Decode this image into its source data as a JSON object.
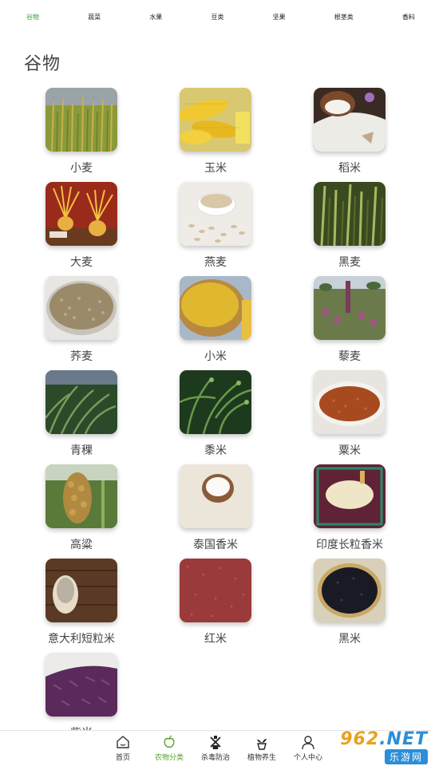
{
  "tabs": [
    "谷物",
    "蔬菜",
    "水果",
    "豆类",
    "坚果",
    "根茎类",
    "香料"
  ],
  "active_tab": "谷物",
  "section_title": "谷物",
  "items": [
    {
      "label": "小麦",
      "image": "wheat-field"
    },
    {
      "label": "玉米",
      "image": "corn-cobs"
    },
    {
      "label": "稻米",
      "image": "rice-bowl"
    },
    {
      "label": "大麦",
      "image": "barley-bundles"
    },
    {
      "label": "燕麦",
      "image": "oat-flakes"
    },
    {
      "label": "黑麦",
      "image": "rye-ears"
    },
    {
      "label": "荞麦",
      "image": "buckwheat-bowl"
    },
    {
      "label": "小米",
      "image": "millet-bowl"
    },
    {
      "label": "藜麦",
      "image": "quinoa-plants"
    },
    {
      "label": "青稞",
      "image": "highland-barley"
    },
    {
      "label": "黍米",
      "image": "proso-millet"
    },
    {
      "label": "粟米",
      "image": "foxtail-millet-grains"
    },
    {
      "label": "高粱",
      "image": "sorghum-head"
    },
    {
      "label": "泰国香米",
      "image": "jasmine-rice"
    },
    {
      "label": "印度长粒香米",
      "image": "basmati-rice"
    },
    {
      "label": "意大利短粒米",
      "image": "arborio-rice-sack"
    },
    {
      "label": "红米",
      "image": "red-rice"
    },
    {
      "label": "黑米",
      "image": "black-rice"
    },
    {
      "label": "紫米",
      "image": "purple-rice"
    }
  ],
  "bottom_nav": [
    {
      "label": "首页",
      "icon": "home-icon"
    },
    {
      "label": "农物分类",
      "icon": "apple-icon"
    },
    {
      "label": "杀毒防治",
      "icon": "pesticide-icon"
    },
    {
      "label": "植物养生",
      "icon": "potted-plant-icon"
    },
    {
      "label": "个人中心",
      "icon": "person-icon"
    }
  ],
  "active_nav": "农物分类",
  "watermark": {
    "top": "962",
    "top_suffix": ".NET",
    "bottom": "乐游网"
  },
  "colors": {
    "accent": "#3a9a3a",
    "nav_active": "#5aa02c"
  }
}
